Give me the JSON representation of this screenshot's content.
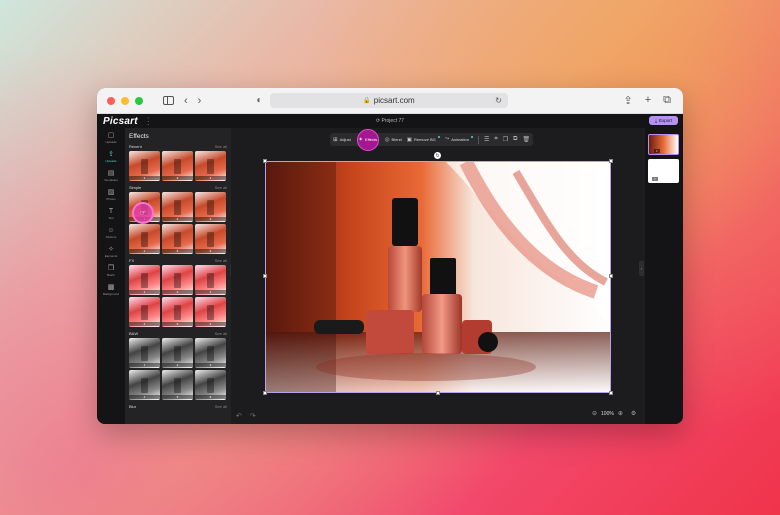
{
  "browser": {
    "url": "picsart.com",
    "traffic_lights": [
      "#ff5f57",
      "#febc2e",
      "#28c840"
    ]
  },
  "app": {
    "logo": "Picsart",
    "project_title": "Project 77",
    "export_label": "Export",
    "accent": "#b592f0",
    "active_color": "#a4178f",
    "highlight_teal": "#55d6c1"
  },
  "rail": [
    {
      "icon": "camera-icon",
      "label": "Uploads"
    },
    {
      "icon": "upload-icon",
      "label": "Uploads",
      "active": true
    },
    {
      "icon": "templates-icon",
      "label": "Templates"
    },
    {
      "icon": "photos-icon",
      "label": "Photos"
    },
    {
      "icon": "text-icon",
      "label": "Text"
    },
    {
      "icon": "stickers-icon",
      "label": "Stickers"
    },
    {
      "icon": "elements-icon",
      "label": "Elements"
    },
    {
      "icon": "batch-icon",
      "label": "Batch"
    },
    {
      "icon": "background-icon",
      "label": "Background"
    }
  ],
  "effects": {
    "title": "Effects",
    "see_all": "See all",
    "sections": [
      {
        "name": "Recent",
        "thumbs": [
          [
            "1",
            "2",
            "3"
          ]
        ]
      },
      {
        "name": "Simple",
        "thumbs": [
          [
            "1",
            "2",
            "3"
          ],
          [
            "4",
            "5",
            "6"
          ]
        ]
      },
      {
        "name": "FX",
        "thumbs": [
          [
            "1",
            "2",
            "3"
          ],
          [
            "4",
            "5",
            "6"
          ]
        ]
      },
      {
        "name": "B&W",
        "thumbs": [
          [
            "1",
            "2",
            "3"
          ],
          [
            "4",
            "5",
            "6"
          ]
        ]
      },
      {
        "name": "Blur",
        "thumbs": []
      }
    ]
  },
  "toolbar": {
    "adjust": "Adjust",
    "effects": "Effects",
    "blend": "Blend",
    "remove_bg": "Remove BG",
    "animation": "Animation"
  },
  "zoom": {
    "value": "100%"
  }
}
